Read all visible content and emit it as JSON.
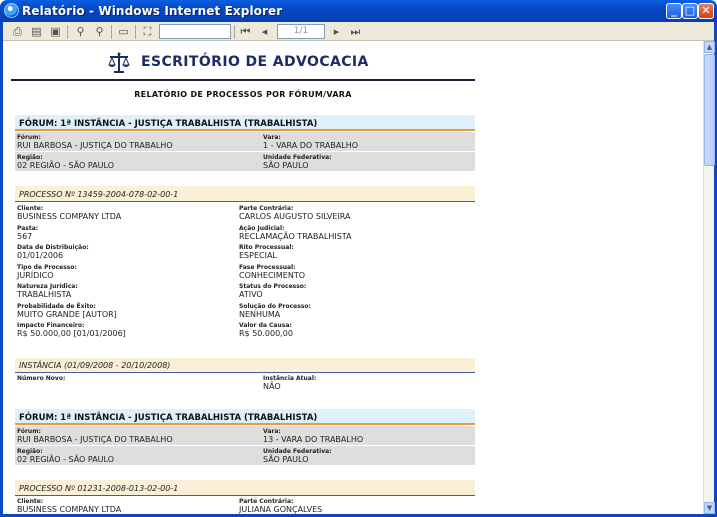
{
  "window": {
    "title": "Relatório - Windows Internet Explorer",
    "min_label": "_",
    "max_label": "□",
    "close_label": "✕"
  },
  "toolbar": {
    "search_value": "",
    "page_indicator": "1/1"
  },
  "report": {
    "firm_name": "ESCRITÓRIO DE ADVOCACIA",
    "title": "RELATÓRIO DE PROCESSOS POR FÓRUM/VARA",
    "forum1": {
      "heading": "FÓRUM: 1ª INSTÂNCIA - JUSTIÇA TRABALHISTA (TRABALHISTA)",
      "forum_label": "Fórum:",
      "forum_value": "RUI BARBOSA - JUSTIÇA DO TRABALHO",
      "vara_label": "Vara:",
      "vara_value": "1 - VARA DO TRABALHO",
      "regiao_label": "Região:",
      "regiao_value": "02 REGIÃO - SÃO PAULO",
      "uf_label": "Unidade Federativa:",
      "uf_value": "SÃO PAULO"
    },
    "process1": {
      "heading": "PROCESSO Nº 13459-2004-078-02-00-1",
      "fields": [
        {
          "label": "Cliente:",
          "value": "BUSINESS COMPANY LTDA"
        },
        {
          "label": "Parte Contrária:",
          "value": "CARLOS AUGUSTO SILVEIRA"
        },
        {
          "label": "Pasta:",
          "value": "567"
        },
        {
          "label": "Ação Judicial:",
          "value": "RECLAMAÇÃO TRABALHISTA"
        },
        {
          "label": "Data de Distribuição:",
          "value": "01/01/2006"
        },
        {
          "label": "Rito Processual:",
          "value": "ESPECIAL"
        },
        {
          "label": "Tipo de Processo:",
          "value": "JURÍDICO"
        },
        {
          "label": "Fase Processual:",
          "value": "CONHECIMENTO"
        },
        {
          "label": "Natureza Jurídica:",
          "value": "TRABALHISTA"
        },
        {
          "label": "Status do Processo:",
          "value": "ATIVO"
        },
        {
          "label": "Probabilidade de Êxito:",
          "value": "MUITO GRANDE [AUTOR]"
        },
        {
          "label": "Solução do Processo:",
          "value": "NENHUMA"
        },
        {
          "label": "Impacto Financeiro:",
          "value": "R$ 50.000,00 [01/01/2006]"
        },
        {
          "label": "Valor da Causa:",
          "value": "R$ 50.000,00"
        }
      ]
    },
    "instance": {
      "heading": "INSTÂNCIA (01/09/2008 - 20/10/2008)",
      "numero_label": "Número Novo:",
      "numero_value": "",
      "atual_label": "Instância Atual:",
      "atual_value": "NÃO"
    },
    "forum2": {
      "heading": "FÓRUM: 1ª INSTÂNCIA - JUSTIÇA TRABALHISTA (TRABALHISTA)",
      "forum_label": "Fórum:",
      "forum_value": "RUI BARBOSA - JUSTIÇA DO TRABALHO",
      "vara_label": "Vara:",
      "vara_value": "13 - VARA DO TRABALHO",
      "regiao_label": "Região:",
      "regiao_value": "02 REGIÃO - SÃO PAULO",
      "uf_label": "Unidade Federativa:",
      "uf_value": "SÃO PAULO"
    },
    "process2": {
      "heading": "PROCESSO Nº 01231-2008-013-02-00-1",
      "cliente_label": "Cliente:",
      "cliente_value": "BUSINESS COMPANY LTDA",
      "parte_label": "Parte Contrária:",
      "parte_value": "JULIANA GONÇALVES"
    }
  }
}
